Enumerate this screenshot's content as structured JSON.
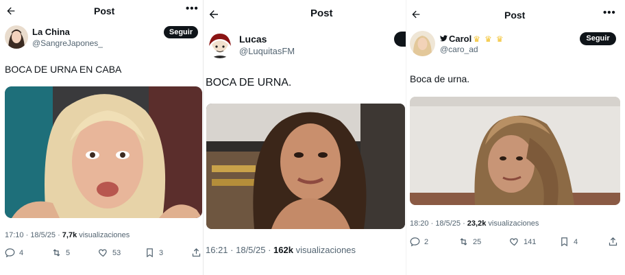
{
  "panels": [
    {
      "header_title": "Post",
      "author": {
        "name": "La China",
        "handle": "@SangreJapones_"
      },
      "follow_label": "Seguir",
      "text": "BOCA DE URNA EN CABA",
      "meta": {
        "time": "17:10",
        "date": "18/5/25",
        "views": "7,7k",
        "views_label": "visualizaciones"
      },
      "actions": {
        "replies": "4",
        "reposts": "5",
        "likes": "53",
        "bookmarks": "3"
      }
    },
    {
      "header_title": "Post",
      "author": {
        "name": "Lucas",
        "handle": "@LuquitasFM"
      },
      "text": "BOCA DE URNA.",
      "meta": {
        "time": "16:21",
        "date": "18/5/25",
        "views": "162k",
        "views_label": "visualizaciones"
      }
    },
    {
      "header_title": "Post",
      "author": {
        "name": "Carol",
        "handle": "@caro_ad"
      },
      "follow_label": "Seguir",
      "text": "Boca de urna.",
      "meta": {
        "time": "18:20",
        "date": "18/5/25",
        "views": "23,2k",
        "views_label": "visualizaciones"
      },
      "actions": {
        "replies": "2",
        "reposts": "25",
        "likes": "141",
        "bookmarks": "4"
      }
    }
  ],
  "colors": {
    "text": "#0f1419",
    "muted": "#536471",
    "button": "#0f1419"
  }
}
